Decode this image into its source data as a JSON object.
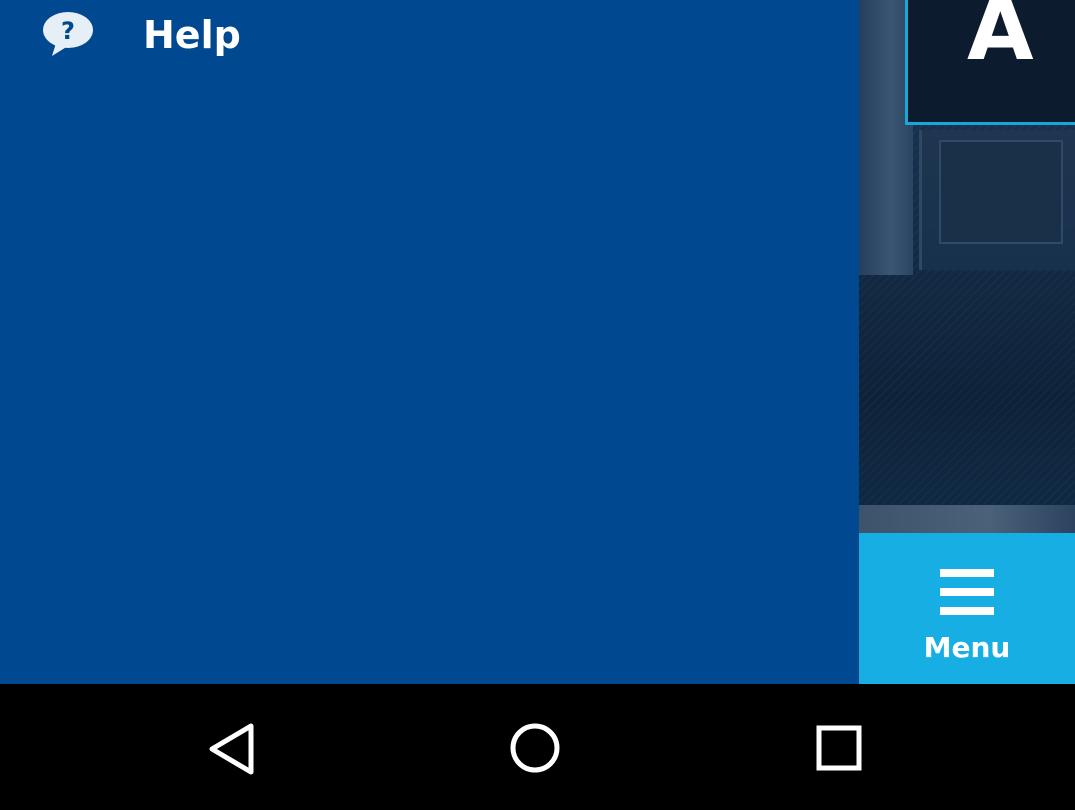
{
  "drawer": {
    "background": "#00488f",
    "items": [
      {
        "label": "Help",
        "icon": "help-speech-bubble-icon"
      }
    ]
  },
  "background_page": {
    "heading_visible": "A",
    "accent_color": "#1aa6d9"
  },
  "menu_button": {
    "label": "Menu",
    "icon": "hamburger-icon",
    "color": "#16aee3"
  },
  "nav_bar": {
    "buttons": [
      {
        "name": "back",
        "icon": "back-triangle-icon"
      },
      {
        "name": "home",
        "icon": "home-circle-icon"
      },
      {
        "name": "recents",
        "icon": "recents-square-icon"
      }
    ]
  }
}
